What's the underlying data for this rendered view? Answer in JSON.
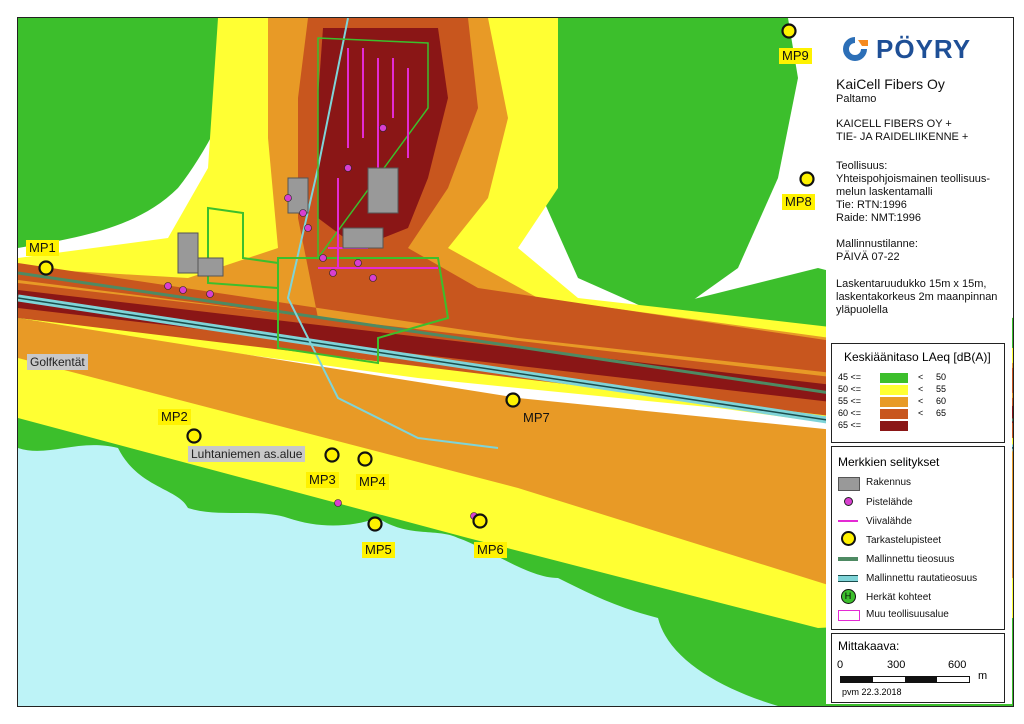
{
  "company_logo": "PÖYRY",
  "client": "KaiCell Fibers Oy",
  "location": "Paltamo",
  "scenario_lines": [
    "KAICELL FIBERS OY +",
    "TIE- JA RAIDELIIKENNE +"
  ],
  "model_lines": [
    "Teollisuus:",
    "Yhteispohjoismainen teollisuus-",
    "melun laskentamalli",
    "Tie: RTN:1996",
    "Raide: NMT:1996"
  ],
  "situation_lines": [
    "Mallinnustilanne:",
    "PÄIVÄ 07-22"
  ],
  "grid_lines": [
    "Laskentaruudukko 15m x 15m,",
    "laskentakorkeus 2m maanpinnan",
    "yläpuolella"
  ],
  "noise_legend": {
    "title": "Keskiäänitaso LAeq [dB(A)]",
    "classes": [
      {
        "low": "45 <=",
        "op": "<",
        "high": "50",
        "color": "#3cbf2c"
      },
      {
        "low": "50 <=",
        "op": "<",
        "high": "55",
        "color": "#ffff33"
      },
      {
        "low": "55 <=",
        "op": "<",
        "high": "60",
        "color": "#e89a26"
      },
      {
        "low": "60 <=",
        "op": "<",
        "high": "65",
        "color": "#c8561e"
      },
      {
        "low": "65 <=",
        "op": "",
        "high": "",
        "color": "#8a1616"
      }
    ]
  },
  "symbol_legend": {
    "title": "Merkkien selitykset",
    "items": [
      {
        "label": "Rakennus",
        "icon": "building-icon"
      },
      {
        "label": "Pistelähde",
        "icon": "point-source-icon"
      },
      {
        "label": "Viivalähde",
        "icon": "line-source-icon"
      },
      {
        "label": "Tarkastelupisteet",
        "icon": "receiver-point-icon"
      },
      {
        "label": "Mallinnettu tieosuus",
        "icon": "road-icon"
      },
      {
        "label": "Mallinnettu rautatieosuus",
        "icon": "railway-icon"
      },
      {
        "label": "Herkät kohteet",
        "icon": "sensitive-site-icon",
        "glyph": "H"
      },
      {
        "label": "Muu teollisuusalue",
        "icon": "industrial-area-icon"
      }
    ]
  },
  "scale": {
    "title": "Mittakaava:",
    "ticks": [
      "0",
      "300",
      "600"
    ],
    "unit": "m"
  },
  "date": "pvm 22.3.2018",
  "map_labels": {
    "points": [
      "MP1",
      "MP2",
      "MP3",
      "MP4",
      "MP5",
      "MP6",
      "MP7",
      "MP8",
      "MP9"
    ],
    "golf": "Golfkentät",
    "residential": "Luhtaniemen as.alue"
  },
  "colors": {
    "water": "#bdf3f7",
    "forest": "#3cbf2c",
    "open_land": "#ffffff",
    "railway": "#7fd4d8"
  }
}
